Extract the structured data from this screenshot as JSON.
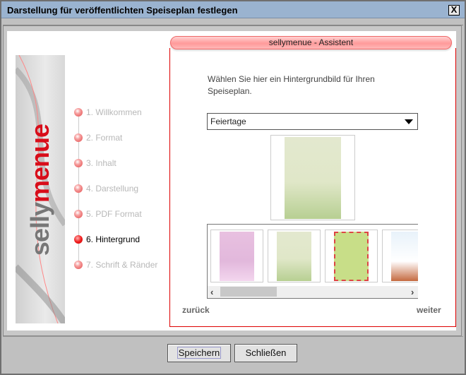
{
  "window": {
    "title": "Darstellung für veröffentlichten Speiseplan festlegen",
    "close": "X"
  },
  "logo": {
    "part1": "selly",
    "part2": "menue"
  },
  "header": "sellymenue - Assistent",
  "steps": [
    {
      "label": "1. Willkommen",
      "active": false
    },
    {
      "label": "2. Format",
      "active": false
    },
    {
      "label": "3. Inhalt",
      "active": false
    },
    {
      "label": "4. Darstellung",
      "active": false
    },
    {
      "label": "5. PDF Format",
      "active": false
    },
    {
      "label": "6. Hintergrund",
      "active": true
    },
    {
      "label": "7. Schrift & Ränder",
      "active": false
    }
  ],
  "instruction": "Wählen Sie hier ein Hintergrundbild für Ihren Speiseplan.",
  "dropdown": {
    "selected": "Feiertage"
  },
  "thumbnails": [
    "pink-hearts",
    "green-easter",
    "flags-green",
    "blue-orange-sport"
  ],
  "nav": {
    "back": "zurück",
    "next": "weiter"
  },
  "buttons": {
    "save": "Speichern",
    "close": "Schließen"
  },
  "colors": {
    "accent": "#d80d1a",
    "titlebar": "#9ab3d0"
  }
}
